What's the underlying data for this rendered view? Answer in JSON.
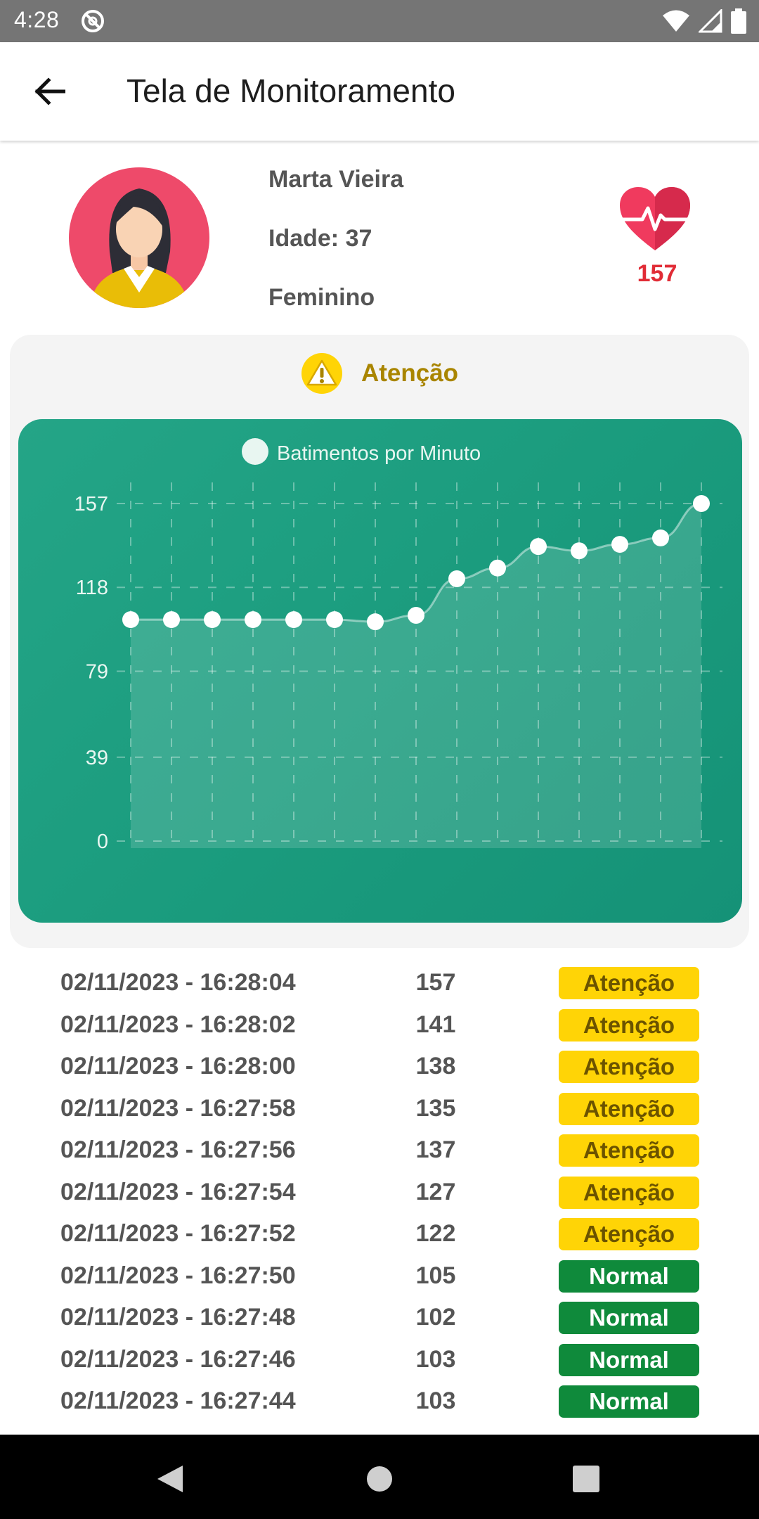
{
  "status_bar": {
    "time": "4:28"
  },
  "app_bar": {
    "title": "Tela de Monitoramento"
  },
  "patient": {
    "name": "Marta Vieira",
    "age": "Idade: 37",
    "gender": "Feminino",
    "bpm": "157"
  },
  "alert": {
    "label": "Atenção"
  },
  "chart_data": {
    "type": "line",
    "legend": "Batimentos por Minuto",
    "y_ticks": [
      "157",
      "118",
      "79",
      "39",
      "0"
    ],
    "ylim": [
      0,
      157
    ],
    "values": [
      103,
      103,
      103,
      103,
      103,
      103,
      102,
      105,
      122,
      127,
      137,
      135,
      138,
      141,
      157
    ],
    "grid": true,
    "area_fill": true
  },
  "history": [
    {
      "time": "02/11/2023 - 16:28:04",
      "bpm": "157",
      "status": "Atenção",
      "level": "warn"
    },
    {
      "time": "02/11/2023 - 16:28:02",
      "bpm": "141",
      "status": "Atenção",
      "level": "warn"
    },
    {
      "time": "02/11/2023 - 16:28:00",
      "bpm": "138",
      "status": "Atenção",
      "level": "warn"
    },
    {
      "time": "02/11/2023 - 16:27:58",
      "bpm": "135",
      "status": "Atenção",
      "level": "warn"
    },
    {
      "time": "02/11/2023 - 16:27:56",
      "bpm": "137",
      "status": "Atenção",
      "level": "warn"
    },
    {
      "time": "02/11/2023 - 16:27:54",
      "bpm": "127",
      "status": "Atenção",
      "level": "warn"
    },
    {
      "time": "02/11/2023 - 16:27:52",
      "bpm": "122",
      "status": "Atenção",
      "level": "warn"
    },
    {
      "time": "02/11/2023 - 16:27:50",
      "bpm": "105",
      "status": "Normal",
      "level": "ok"
    },
    {
      "time": "02/11/2023 - 16:27:48",
      "bpm": "102",
      "status": "Normal",
      "level": "ok"
    },
    {
      "time": "02/11/2023 - 16:27:46",
      "bpm": "103",
      "status": "Normal",
      "level": "ok"
    },
    {
      "time": "02/11/2023 - 16:27:44",
      "bpm": "103",
      "status": "Normal",
      "level": "ok"
    }
  ],
  "colors": {
    "status_bar": "#757575",
    "chart_bg": "#1a9b7d",
    "warn": "#ffd406",
    "ok": "#0f8a3b",
    "bpm": "#e12c36"
  }
}
